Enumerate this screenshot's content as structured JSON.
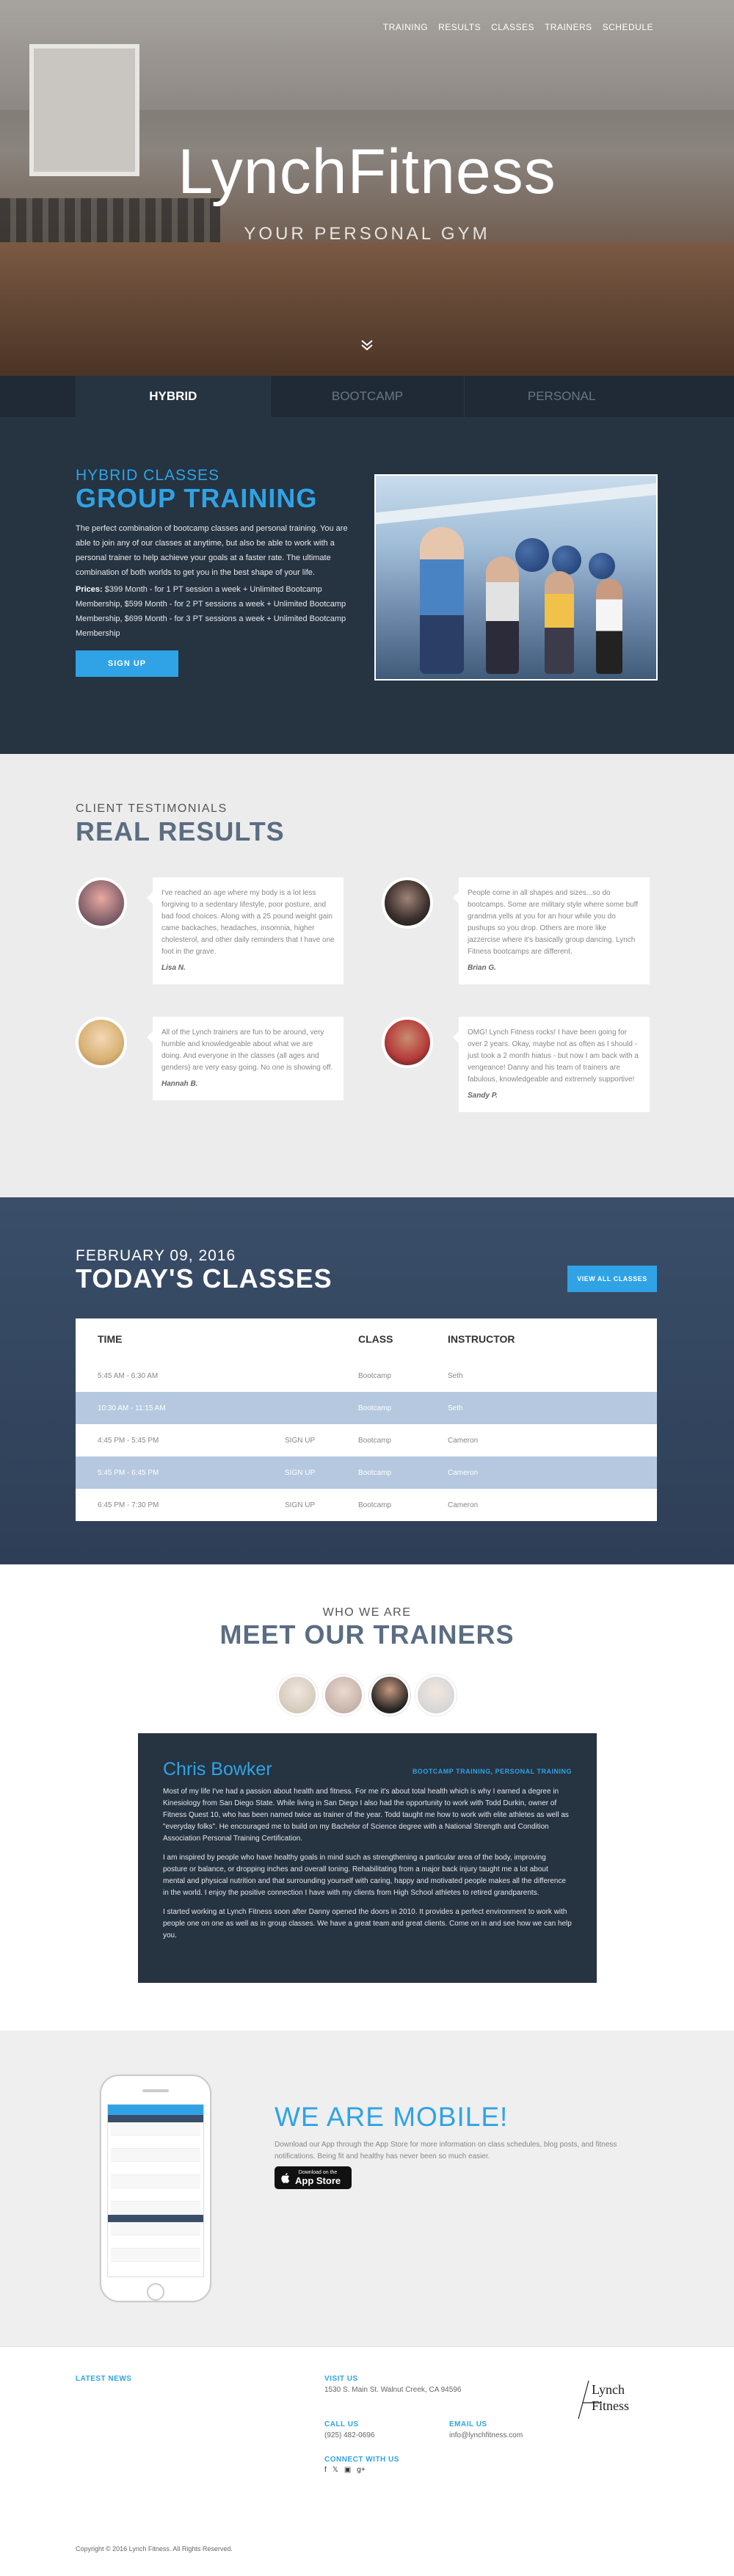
{
  "nav": {
    "items": [
      "TRAINING",
      "RESULTS",
      "CLASSES",
      "TRAINERS",
      "SCHEDULE"
    ]
  },
  "hero": {
    "brand": "LynchFitness",
    "tagline": "YOUR PERSONAL GYM"
  },
  "tabs": [
    {
      "label": "HYBRID",
      "active": true
    },
    {
      "label": "BOOTCAMP"
    },
    {
      "label": "PERSONAL"
    }
  ],
  "hybrid": {
    "small": "HYBRID CLASSES",
    "big": "GROUP TRAINING",
    "desc": "The perfect combination of bootcamp classes and personal training. You are able to join any of our classes at anytime, but also be able to work with a personal trainer to help achieve your goals at a faster rate. The ultimate combination of both worlds to get you in the best shape of your life.",
    "prices_label": "Prices:",
    "prices": "$399 Month - for 1 PT session a week + Unlimited Bootcamp Membership, $599 Month - for 2 PT sessions a week + Unlimited Bootcamp Membership, $699 Month - for 3 PT sessions a week + Unlimited Bootcamp Membership",
    "signup": "SIGN UP"
  },
  "testimonials": {
    "small": "CLIENT TESTIMONIALS",
    "big": "REAL RESULTS",
    "items": [
      {
        "text": "I've reached an age where my body is a lot less forgiving to a sedentary lifestyle, poor posture, and bad food choices. Along with a 25 pound weight gain came backaches, headaches, insomnia, higher cholesterol, and other daily reminders that I have one foot in the grave.",
        "author": "Lisa N."
      },
      {
        "text": "People come in all shapes and sizes...so do bootcamps. Some are military style where some buff grandma yells at you for an hour while you do pushups so you drop. Others are more like jazzercise where it's basically group dancing. Lynch Fitness bootcamps are different.",
        "author": "Brian G."
      },
      {
        "text": "All of the Lynch trainers are fun to be around, very humble and knowledgeable about what we are doing. And everyone in the classes (all ages and genders) are very easy going. No one is showing off.",
        "author": "Hannah B."
      },
      {
        "text": "OMG! Lynch Fitness rocks! I have been going for over 2 years. Okay, maybe not as often as I should - just took a 2 month hiatus - but now I am back with a vengeance! Danny and his team of trainers are fabulous, knowledgeable and extremely supportive!",
        "author": "Sandy P."
      }
    ]
  },
  "classes": {
    "date": "FEBRUARY 09, 2016",
    "title": "TODAY'S CLASSES",
    "view_all": "VIEW ALL CLASSES",
    "headers": [
      "TIME",
      "CLASS",
      "INSTRUCTOR"
    ],
    "rows": [
      {
        "time": "5:45 AM - 6:30 AM",
        "action": "",
        "class": "Bootcamp",
        "instructor": "Seth",
        "highlight": false
      },
      {
        "time": "10:30 AM - 11:15 AM",
        "action": "",
        "class": "Bootcamp",
        "instructor": "Seth",
        "highlight": true
      },
      {
        "time": "4:45 PM - 5:45 PM",
        "action": "SIGN UP",
        "class": "Bootcamp",
        "instructor": "Cameron",
        "highlight": false
      },
      {
        "time": "5:45 PM - 6:45 PM",
        "action": "SIGN UP",
        "class": "Bootcamp",
        "instructor": "Cameron",
        "highlight": true
      },
      {
        "time": "6:45 PM - 7:30 PM",
        "action": "SIGN UP",
        "class": "Bootcamp",
        "instructor": "Cameron",
        "highlight": false
      }
    ]
  },
  "trainers": {
    "small": "WHO WE ARE",
    "big": "MEET OUR TRAINERS",
    "name": "Chris Bowker",
    "role": "BOOTCAMP TRAINING, PERSONAL TRAINING",
    "paragraphs": [
      "Most of my life I've had a passion about health and fitness. For me it's about total health which is why I earned a degree in Kinesiology from San Diego State. While living in San Diego I also had the opportunity to work with Todd Durkin, owner of Fitness Quest 10, who has been named twice as trainer of the year. Todd taught me how to work with elite athletes as well as \"everyday folks\". He encouraged me to build on my Bachelor of Science degree with a National Strength and Condition Association Personal Training Certification.",
      "I am inspired by people who have healthy goals in mind such as strengthening a particular area of the body, improving posture or balance, or dropping inches and overall toning. Rehabilitating from a major back injury taught me a lot about mental and physical nutrition and that surrounding yourself with caring, happy and motivated people makes all the difference in the world. I enjoy the positive connection I have with my clients from High School athletes to retired grandparents.",
      "I started working at Lynch Fitness soon after Danny opened the doors in 2010. It provides a perfect environment to work with people one on one as well as in group classes. We have a great team and great clients. Come on in and see how we can help you."
    ]
  },
  "mobile": {
    "title": "WE ARE MOBILE!",
    "text": "Download our App through the App Store for more information on class schedules, blog posts, and fitness notifications. Being fit and healthy has never been so much easier.",
    "store_small": "Download on the",
    "store_big": "App Store"
  },
  "footer": {
    "latest_news": "LATEST NEWS",
    "visit_us": "VISIT US",
    "address": "1530 S. Main St. Walnut Creek, CA 94596",
    "call_us": "CALL US",
    "phone": "(925) 482-0696",
    "email_us": "EMAIL US",
    "email": "info@lynchfitness.com",
    "connect": "CONNECT WITH US",
    "logo_line1": "Lynch",
    "logo_line2": "Fitness",
    "copyright": "Copyright © 2016 Lynch Fitness. All Rights Reserved."
  }
}
